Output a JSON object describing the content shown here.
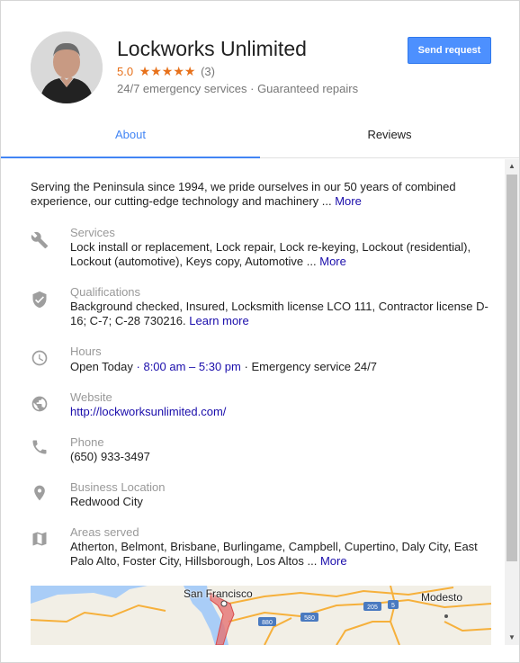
{
  "business": {
    "name": "Lockworks Unlimited",
    "rating": "5.0",
    "stars": "★★★★★",
    "review_count": "(3)",
    "subtitle": "24/7 emergency services · Guaranteed repairs",
    "send_request_label": "Send request"
  },
  "tabs": [
    {
      "label": "About",
      "active": true
    },
    {
      "label": "Reviews",
      "active": false
    }
  ],
  "about": {
    "description": "Serving the Peninsula since 1994, we pride ourselves in our 50 years of combined experience, our cutting-edge technology and machinery ...",
    "description_more": "More",
    "services": {
      "icon": "wrench-icon",
      "label": "Services",
      "value": "Lock install or replacement, Lock repair, Lock re-keying, Lockout (residential), Lockout (automotive), Keys copy, Automotive ...",
      "more": "More"
    },
    "qualifications": {
      "icon": "shield-check-icon",
      "label": "Qualifications",
      "value": "Background checked, Insured, Locksmith license LCO 111, Contractor license D-16; C-7; C-28 730216.",
      "learn_more": "Learn more"
    },
    "hours": {
      "icon": "clock-icon",
      "label": "Hours",
      "open_today": "Open Today",
      "sep1": "·",
      "time_range": "8:00 am – 5:30 pm",
      "sep2": "·",
      "emergency": "Emergency service 24/7"
    },
    "website": {
      "icon": "globe-icon",
      "label": "Website",
      "url": "http://lockworksunlimited.com/"
    },
    "phone": {
      "icon": "phone-icon",
      "label": "Phone",
      "value": "(650) 933-3497"
    },
    "location": {
      "icon": "location-pin-icon",
      "label": "Business Location",
      "value": "Redwood City"
    },
    "areas": {
      "icon": "map-icon",
      "label": "Areas served",
      "value": "Atherton, Belmont, Brisbane, Burlingame, Campbell, Cupertino, Daly City, East Palo Alto, Foster City, Hillsborough, Los Altos ...",
      "more": "More"
    }
  },
  "map": {
    "labels": [
      "San Francisco",
      "Modesto"
    ],
    "highway_shields": [
      "880",
      "580",
      "205",
      "5"
    ]
  },
  "colors": {
    "accent_blue": "#4285f4",
    "button_blue": "#4d90fe",
    "star_orange": "#e7711b",
    "link_blue": "#1a0dab"
  }
}
